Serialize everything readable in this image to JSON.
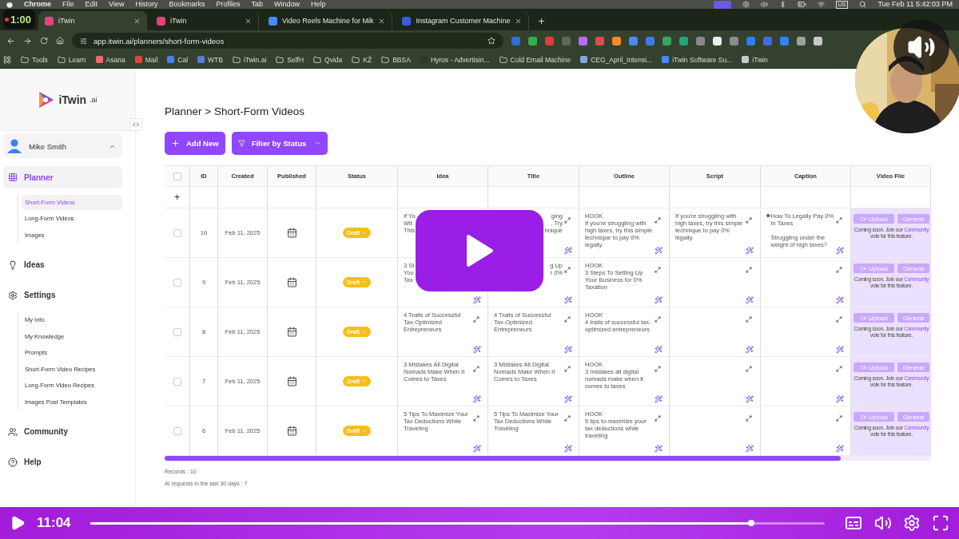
{
  "menubar": {
    "app": "Chrome",
    "menus": [
      "File",
      "Edit",
      "View",
      "History",
      "Bookmarks",
      "Profiles",
      "Tab",
      "Window",
      "Help"
    ],
    "keyboard": "US",
    "clock": "Tue Feb 11  5:42:03 PM"
  },
  "recording": {
    "timer": "1:00"
  },
  "tabs": [
    {
      "title": "iTwin",
      "selected": true
    },
    {
      "title": "iTwin",
      "selected": false
    },
    {
      "title": "Video Reels Machine for Mik",
      "selected": false
    },
    {
      "title": "Instagram Customer Machine",
      "selected": false
    }
  ],
  "address_bar": {
    "url": "app.itwin.ai/planners/short-form-videos"
  },
  "bookmarks": [
    {
      "label": "Tools",
      "kind": "folder"
    },
    {
      "label": "Learn",
      "kind": "folder"
    },
    {
      "label": "Asana",
      "kind": "site",
      "color": "#f06a6a"
    },
    {
      "label": "Mail",
      "kind": "site",
      "color": "#ea4335"
    },
    {
      "label": "Cal",
      "kind": "site",
      "color": "#4285f4"
    },
    {
      "label": "WTB",
      "kind": "site",
      "color": "#5b7bd5"
    },
    {
      "label": "iTwin.ai",
      "kind": "folder"
    },
    {
      "label": "SelfH",
      "kind": "folder"
    },
    {
      "label": "Qvida",
      "kind": "folder"
    },
    {
      "label": "KŽ",
      "kind": "folder"
    },
    {
      "label": "BBSA",
      "kind": "folder"
    },
    {
      "label": "Hyros - Advertisin...",
      "kind": "site",
      "color": "#2b3a28"
    },
    {
      "label": "Cold Email Machine",
      "kind": "folder"
    },
    {
      "label": "CEG_April_Intensi...",
      "kind": "site",
      "color": "#7fa7d9"
    },
    {
      "label": "iTwin Software Su...",
      "kind": "site",
      "color": "#4a8af4"
    },
    {
      "label": "iTwin",
      "kind": "site",
      "color": "#c9c9c9"
    }
  ],
  "sidebar": {
    "logo": {
      "name": "iTwin",
      "suffix": ".ai"
    },
    "user": {
      "name": "Mike Smith",
      "expanded": true
    },
    "nav": [
      {
        "label": "Planner",
        "selected": true,
        "children": [
          {
            "label": "Short-Form Videos",
            "selected": true
          },
          {
            "label": "Long-Form Videos",
            "selected": false
          },
          {
            "label": "Images",
            "selected": false
          }
        ]
      },
      {
        "label": "Ideas",
        "selected": false
      },
      {
        "label": "Settings",
        "selected": false,
        "children": [
          {
            "label": "My Info",
            "selected": false
          },
          {
            "label": "My Knowledge",
            "selected": false
          },
          {
            "label": "Prompts",
            "selected": false
          },
          {
            "label": "Short-Form Video Recipes",
            "selected": false
          },
          {
            "label": "Long-Form Video Recipes",
            "selected": false
          },
          {
            "label": "Images Post Templates",
            "selected": false
          }
        ]
      },
      {
        "label": "Community",
        "selected": false
      },
      {
        "label": "Help",
        "selected": false
      }
    ]
  },
  "page": {
    "breadcrumb": "Planner > Short-Form Videos",
    "buttons": [
      {
        "label": "Add New",
        "kind": "add"
      },
      {
        "label": "Filter by Status",
        "kind": "filter"
      }
    ]
  },
  "table": {
    "add_row": "+",
    "columns": [
      {
        "kind": "checkbox",
        "checked": false
      },
      {
        "label": "ID"
      },
      {
        "label": "Created"
      },
      {
        "label": "Published"
      },
      {
        "label": "Status"
      },
      {
        "label": "Idea"
      },
      {
        "label": "Title"
      },
      {
        "label": "Outline"
      },
      {
        "label": "Script"
      },
      {
        "label": "Caption"
      },
      {
        "label": "Video File"
      }
    ],
    "rows": [
      {
        "cells": [
          {
            "kind": "checkbox",
            "checked": false
          },
          {
            "kind": "value",
            "text": "10"
          },
          {
            "kind": "value",
            "text": "Feb 11, 2025"
          },
          {
            "kind": "calendar"
          },
          {
            "kind": "status",
            "text": "Draft"
          },
          {
            "kind": "content",
            "text": "If Yo\nWit\nThis",
            "expand_icon": false,
            "wand_icon": false
          },
          {
            "kind": "content",
            "text": "ging\n, Try\nhnique",
            "cut_left": true
          },
          {
            "kind": "content",
            "heading": "HOOK",
            "text": "If you're struggling with high taxes, try this simple technique to pay 0% legally."
          },
          {
            "kind": "content",
            "text": "If you're struggling with high taxes, try this simple technique to pay 0% legally."
          },
          {
            "kind": "content",
            "text": "How To Legally Pay 0% In Taxes\n\nStruggling under the weight of high taxes?",
            "emoji": true
          },
          {
            "kind": "video",
            "upload": "Upload",
            "generate": "Generat",
            "note": "Coming soon. Join our",
            "link": "Community",
            "note_end": "vote for this feature."
          }
        ]
      },
      {
        "cells": [
          {
            "kind": "checkbox",
            "checked": false
          },
          {
            "kind": "value",
            "text": "9"
          },
          {
            "kind": "value",
            "text": "Feb 11, 2025"
          },
          {
            "kind": "calendar"
          },
          {
            "kind": "status",
            "text": "Draft"
          },
          {
            "kind": "content",
            "text": "3 St\nYou\nTax",
            "expand_icon": false
          },
          {
            "kind": "content",
            "text": "g Up\nr 0%",
            "cut_left": true
          },
          {
            "kind": "content",
            "heading": "HOOK",
            "text": "3 Steps To Setting Up Your Business for 0% Taxation"
          },
          {
            "kind": "content"
          },
          {
            "kind": "content"
          },
          {
            "kind": "video",
            "upload": "Upload",
            "generate": "Generat",
            "note": "Coming soon. Join our",
            "link": "Community",
            "note_end": "vote for this feature."
          }
        ]
      },
      {
        "cells": [
          {
            "kind": "checkbox",
            "checked": false
          },
          {
            "kind": "value",
            "text": "8"
          },
          {
            "kind": "value",
            "text": "Feb 11, 2025"
          },
          {
            "kind": "calendar"
          },
          {
            "kind": "status",
            "text": "Draft"
          },
          {
            "kind": "content",
            "text": "4 Traits of Successful Tax-Optimized Entrepreneurs"
          },
          {
            "kind": "content",
            "text": "4 Traits of Successful Tax-Optimized Entrepreneurs"
          },
          {
            "kind": "content",
            "heading": "HOOK",
            "text": "4 traits of successful tax-optimized entrepreneurs"
          },
          {
            "kind": "content"
          },
          {
            "kind": "content"
          },
          {
            "kind": "video",
            "upload": "Upload",
            "generate": "Generat",
            "note": "Coming soon. Join our",
            "link": "Community",
            "note_end": "vote for this feature."
          }
        ]
      },
      {
        "cells": [
          {
            "kind": "checkbox",
            "checked": false
          },
          {
            "kind": "value",
            "text": "7"
          },
          {
            "kind": "value",
            "text": "Feb 11, 2025"
          },
          {
            "kind": "calendar"
          },
          {
            "kind": "status",
            "text": "Draft"
          },
          {
            "kind": "content",
            "text": "3 Mistakes All Digital Nomads Make When It Comes to Taxes"
          },
          {
            "kind": "content",
            "text": "3 Mistakes All Digital Nomads Make When It Comes to Taxes"
          },
          {
            "kind": "content",
            "heading": "HOOK",
            "text": "3 mistakes all digital nomads make when it comes to taxes"
          },
          {
            "kind": "content"
          },
          {
            "kind": "content"
          },
          {
            "kind": "video",
            "upload": "Upload",
            "generate": "Generat",
            "note": "Coming soon. Join our",
            "link": "Community",
            "note_end": "vote for this feature."
          }
        ]
      },
      {
        "cells": [
          {
            "kind": "checkbox",
            "checked": false
          },
          {
            "kind": "value",
            "text": "6"
          },
          {
            "kind": "value",
            "text": "Feb 11, 2025"
          },
          {
            "kind": "calendar"
          },
          {
            "kind": "status",
            "text": "Draft"
          },
          {
            "kind": "content",
            "text": "5 Tips To Maximize Your Tax Deductions While Traveling"
          },
          {
            "kind": "content",
            "text": "5 Tips To Maximize Your Tax Deductions While Traveling"
          },
          {
            "kind": "content",
            "heading": "HOOK",
            "text": "5 tips to maximize your tax deductions while traveling"
          },
          {
            "kind": "content"
          },
          {
            "kind": "content"
          },
          {
            "kind": "video",
            "upload": "Upload",
            "generate": "Generat",
            "note": "Coming soon. Join our",
            "link": "Community",
            "note_end": "vote for this feature."
          }
        ]
      }
    ]
  },
  "footer": {
    "records": "Records : 10",
    "ai_requests": "AI requests in the last 30 days : 7"
  },
  "player": {
    "playing": false,
    "time": "11:04",
    "level": 0.9
  }
}
